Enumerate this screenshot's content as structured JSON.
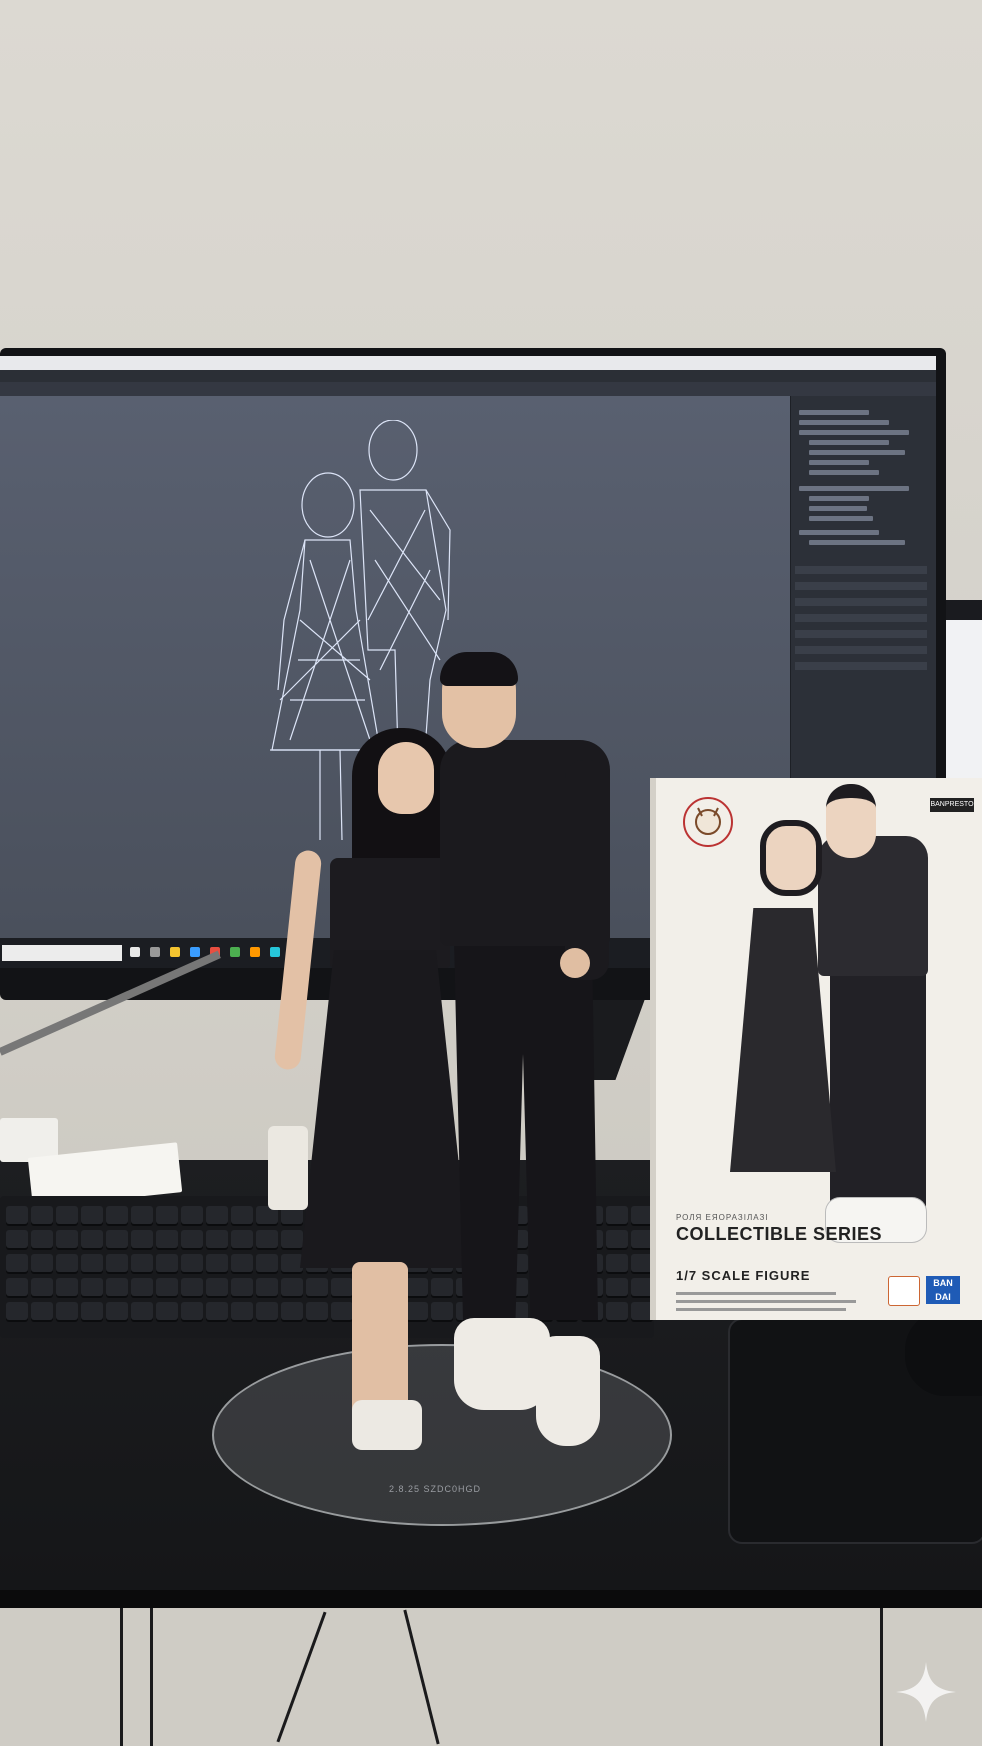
{
  "scene": {
    "description_tags": [
      "figurine",
      "monitor",
      "3d-wireframe",
      "collectible-box",
      "desk"
    ]
  },
  "monitor": {
    "app": "3d-modeling-software",
    "viewport": "wireframe-couple"
  },
  "figure_base": {
    "engraving": "2.8.25 SZDC0HGD"
  },
  "box": {
    "subtitle": "РОЛЯ ЕЯОРАЗІЛАЗІ",
    "title": "COLLECTIBLE SERIES",
    "scale": "1/7 SCALE FIGURE",
    "brand_top": "BANPRESTO",
    "brand_bottom": "BAN DAI"
  },
  "colors": {
    "wall": "#d6d3cc",
    "desk": "#1d1e21",
    "screen": "#4b5260",
    "wireframe": "#dfe8ff",
    "box": "#f2efe9",
    "bandai_blue": "#1f5bb6"
  },
  "icons": [
    "gemini-sparkle-icon",
    "axis-gizmo-icon",
    "box-logo-icon"
  ]
}
